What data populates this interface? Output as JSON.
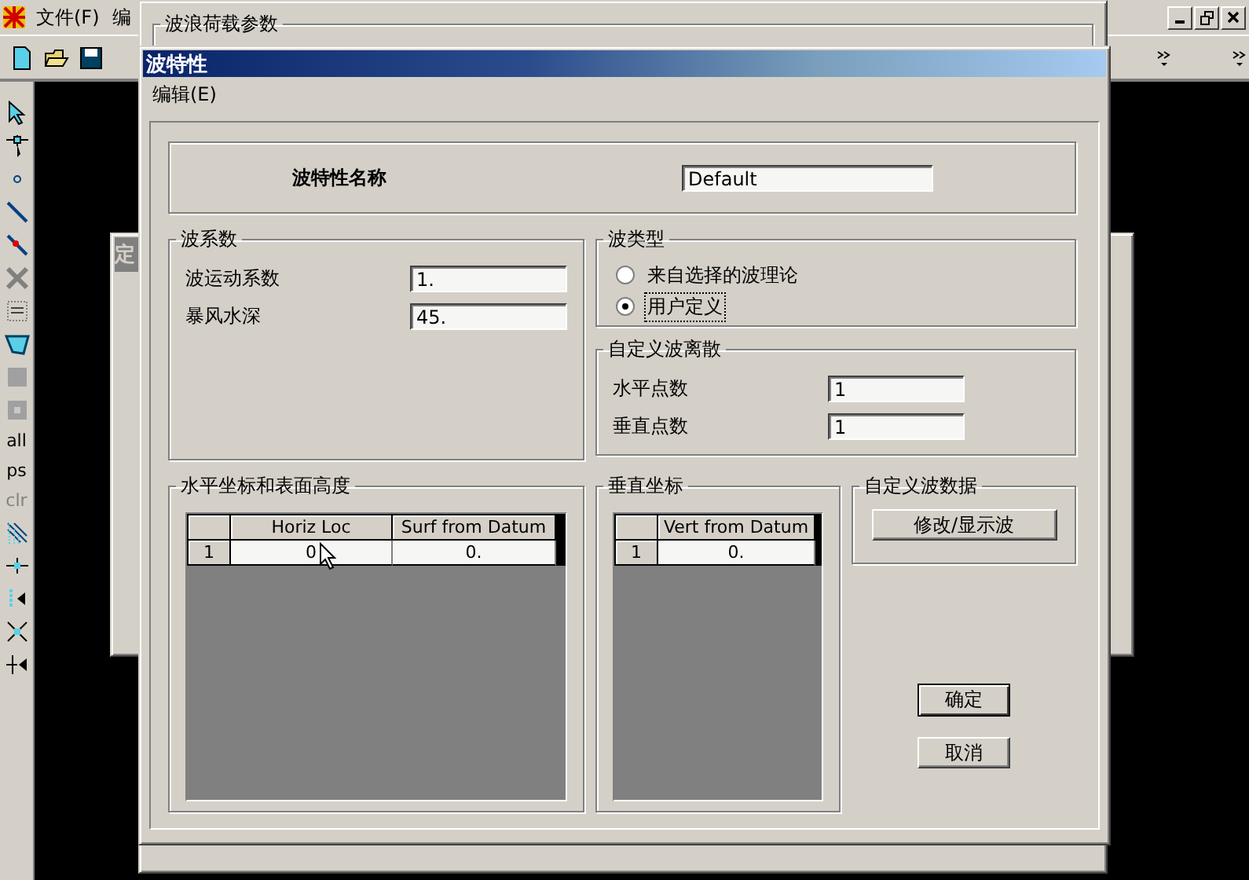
{
  "app": {
    "menu": [
      "文件(F)",
      "编"
    ]
  },
  "back_dialog": {
    "title": "定"
  },
  "back_group": {
    "title": "波浪荷载参数"
  },
  "left_toolbar": {
    "text_tools": [
      {
        "label": "all",
        "disabled": false
      },
      {
        "label": "ps",
        "disabled": false
      },
      {
        "label": "clr",
        "disabled": true
      }
    ]
  },
  "dialog": {
    "title": "波特性",
    "menu": [
      "编辑(E)"
    ],
    "name_field": {
      "label": "波特性名称",
      "value": "Default"
    },
    "coefficients": {
      "title": "波系数",
      "fields": [
        {
          "label": "波运动系数",
          "value": "1."
        },
        {
          "label": "暴风水深",
          "value": "45."
        }
      ]
    },
    "wave_type": {
      "title": "波类型",
      "options": [
        {
          "label": "来自选择的波理论",
          "selected": false
        },
        {
          "label": "用户定义",
          "selected": true
        }
      ]
    },
    "discretization": {
      "title": "自定义波离散",
      "fields": [
        {
          "label": "水平点数",
          "value": "1"
        },
        {
          "label": "垂直点数",
          "value": "1"
        }
      ]
    },
    "horizontal_grid": {
      "title": "水平坐标和表面高度",
      "columns": [
        "Horiz Loc",
        "Surf from Datum"
      ],
      "rows": [
        {
          "index": "1",
          "cells": [
            "0",
            "0."
          ]
        }
      ]
    },
    "vertical_grid": {
      "title": "垂直坐标",
      "columns": [
        "Vert from Datum"
      ],
      "rows": [
        {
          "index": "1",
          "cells": [
            "0."
          ]
        }
      ]
    },
    "custom_data": {
      "title": "自定义波数据",
      "button": "修改/显示波"
    },
    "buttons": [
      {
        "label": "确定",
        "default": true
      },
      {
        "label": "取消",
        "default": false
      }
    ]
  }
}
